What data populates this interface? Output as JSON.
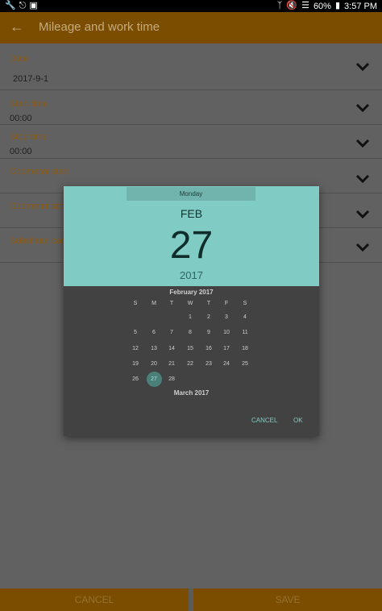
{
  "status_bar": {
    "left_icons": [
      "wrench-icon",
      "usb-icon",
      "cast-icon"
    ],
    "right_icons": [
      "bluetooth-icon",
      "mute-icon",
      "wifi-icon"
    ],
    "battery": "60%",
    "time": "3:57 PM"
  },
  "app_bar": {
    "title": "Mileage and work time",
    "back_icon": "arrow-left-icon"
  },
  "form": {
    "date": {
      "label": "Date",
      "value": "2017-9-1"
    },
    "start_time": {
      "label": "Start time",
      "value": "00:00"
    },
    "stop_time": {
      "label": "Stop time",
      "value": "00:00"
    },
    "odometer_start": {
      "label": "Odometer start"
    },
    "odometer_stop": {
      "label": "Odometer sto"
    },
    "substitute_car": {
      "label": "Substitute car"
    }
  },
  "bottom": {
    "cancel": "CANCEL",
    "save": "SAVE"
  },
  "date_picker": {
    "day_of_week": "Monday",
    "month_short": "FEB",
    "day": "27",
    "year": "2017",
    "month_title": "February 2017",
    "weekdays": [
      "S",
      "M",
      "T",
      "W",
      "T",
      "F",
      "S"
    ],
    "weeks": [
      [
        "",
        "",
        "",
        "1",
        "2",
        "3",
        "4"
      ],
      [
        "5",
        "6",
        "7",
        "8",
        "9",
        "10",
        "11"
      ],
      [
        "12",
        "13",
        "14",
        "15",
        "16",
        "17",
        "18"
      ],
      [
        "19",
        "20",
        "21",
        "22",
        "23",
        "24",
        "25"
      ],
      [
        "26",
        "27",
        "28",
        "",
        "",
        "",
        ""
      ]
    ],
    "selected_day": "27",
    "next_month_title": "March 2017",
    "cancel": "CANCEL",
    "ok": "OK"
  },
  "colors": {
    "app_bar": "#7a4d00",
    "accent_teal": "#80cbc4",
    "label": "#8a5a12",
    "dialog_bg": "#424242",
    "scrim_bg": "#616161"
  }
}
